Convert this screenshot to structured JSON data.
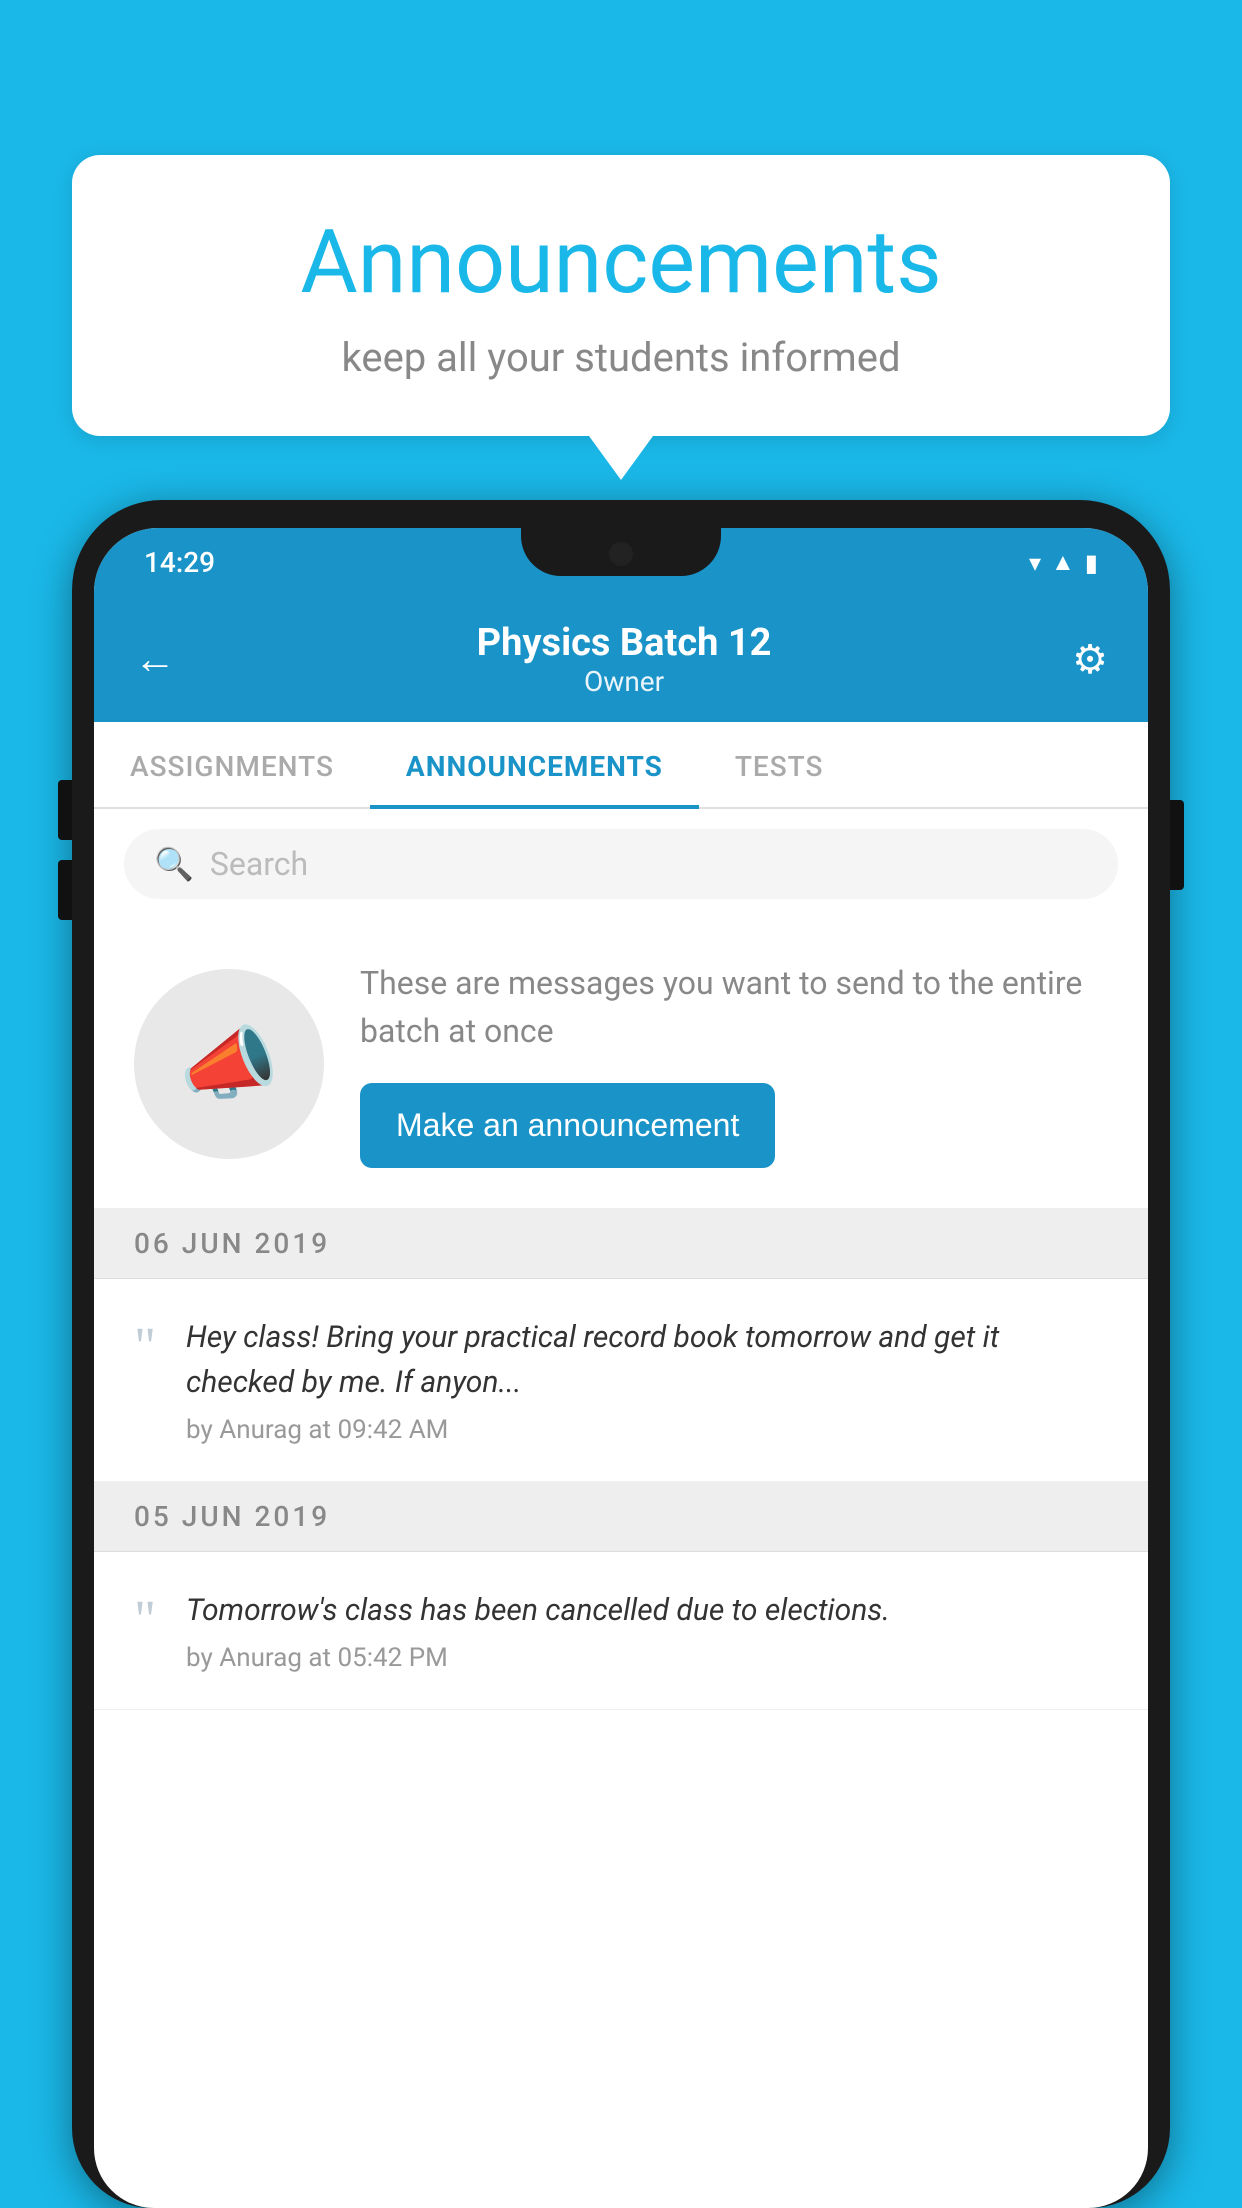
{
  "background_color": "#1ab8e8",
  "speech_bubble": {
    "title": "Announcements",
    "subtitle": "keep all your students informed"
  },
  "phone": {
    "status_bar": {
      "time": "14:29",
      "icons": [
        "wifi",
        "signal",
        "battery"
      ]
    },
    "header": {
      "title": "Physics Batch 12",
      "subtitle": "Owner",
      "back_label": "←",
      "gear_label": "⚙"
    },
    "tabs": [
      {
        "label": "ASSIGNMENTS",
        "active": false
      },
      {
        "label": "ANNOUNCEMENTS",
        "active": true
      },
      {
        "label": "TESTS",
        "active": false
      }
    ],
    "search": {
      "placeholder": "Search"
    },
    "promo": {
      "description": "These are messages you want to send to the entire batch at once",
      "button_label": "Make an announcement"
    },
    "announcements": [
      {
        "date": "06  JUN  2019",
        "text": "Hey class! Bring your practical record book tomorrow and get it checked by me. If anyon...",
        "meta": "by Anurag at 09:42 AM"
      },
      {
        "date": "05  JUN  2019",
        "text": "Tomorrow's class has been cancelled due to elections.",
        "meta": "by Anurag at 05:42 PM"
      }
    ]
  }
}
